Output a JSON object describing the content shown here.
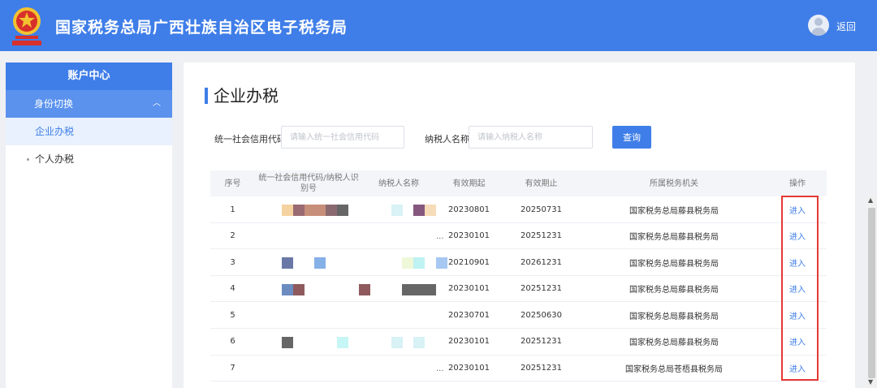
{
  "header": {
    "title": "国家税务总局广西壮族自治区电子税务局",
    "back": "返回",
    "logo_icon": "tax-emblem-icon",
    "avatar_icon": "user-avatar-icon"
  },
  "sidebar": {
    "heading": "账户中心",
    "group": {
      "label": "身份切换",
      "icon": "chevron-up-icon"
    },
    "sub_item": "企业办税",
    "item": "个人办税"
  },
  "main": {
    "title": "企业办税",
    "filters": {
      "credit_code_label": "统一社会信用代码",
      "credit_code_placeholder": "请输入统一社会信用代码",
      "taxpayer_name_label": "纳税人名称",
      "taxpayer_name_placeholder": "请输入纳税人名称",
      "query_button": "查询"
    },
    "table": {
      "headers": [
        "序号",
        "统一社会信用代码/纳税人识别号",
        "纳税人名称",
        "有效期起",
        "有效期止",
        "所属税务机关",
        "操作"
      ],
      "rows": [
        {
          "index": "1",
          "start": "20230801",
          "end": "20250731",
          "authority": "国家税务总局藤县税务局",
          "action": "进入",
          "ellipsis": ""
        },
        {
          "index": "2",
          "start": "20230101",
          "end": "20251231",
          "authority": "国家税务总局藤县税务局",
          "action": "进入",
          "ellipsis": "..."
        },
        {
          "index": "3",
          "start": "20210901",
          "end": "20261231",
          "authority": "国家税务总局藤县税务局",
          "action": "进入",
          "ellipsis": ""
        },
        {
          "index": "4",
          "start": "20230101",
          "end": "20251231",
          "authority": "国家税务总局藤县税务局",
          "action": "进入",
          "ellipsis": ""
        },
        {
          "index": "5",
          "start": "20230701",
          "end": "20250630",
          "authority": "国家税务总局藤县税务局",
          "action": "进入",
          "ellipsis": ""
        },
        {
          "index": "6",
          "start": "20230101",
          "end": "20251231",
          "authority": "国家税务总局藤县税务局",
          "action": "进入",
          "ellipsis": ""
        },
        {
          "index": "7",
          "start": "20230101",
          "end": "20251231",
          "authority": "国家税务总局苍梧县税务局",
          "action": "进入",
          "ellipsis": "..."
        }
      ]
    }
  },
  "colors": {
    "brand_blue": "#3f7ee8",
    "highlight_red": "#e53935"
  }
}
